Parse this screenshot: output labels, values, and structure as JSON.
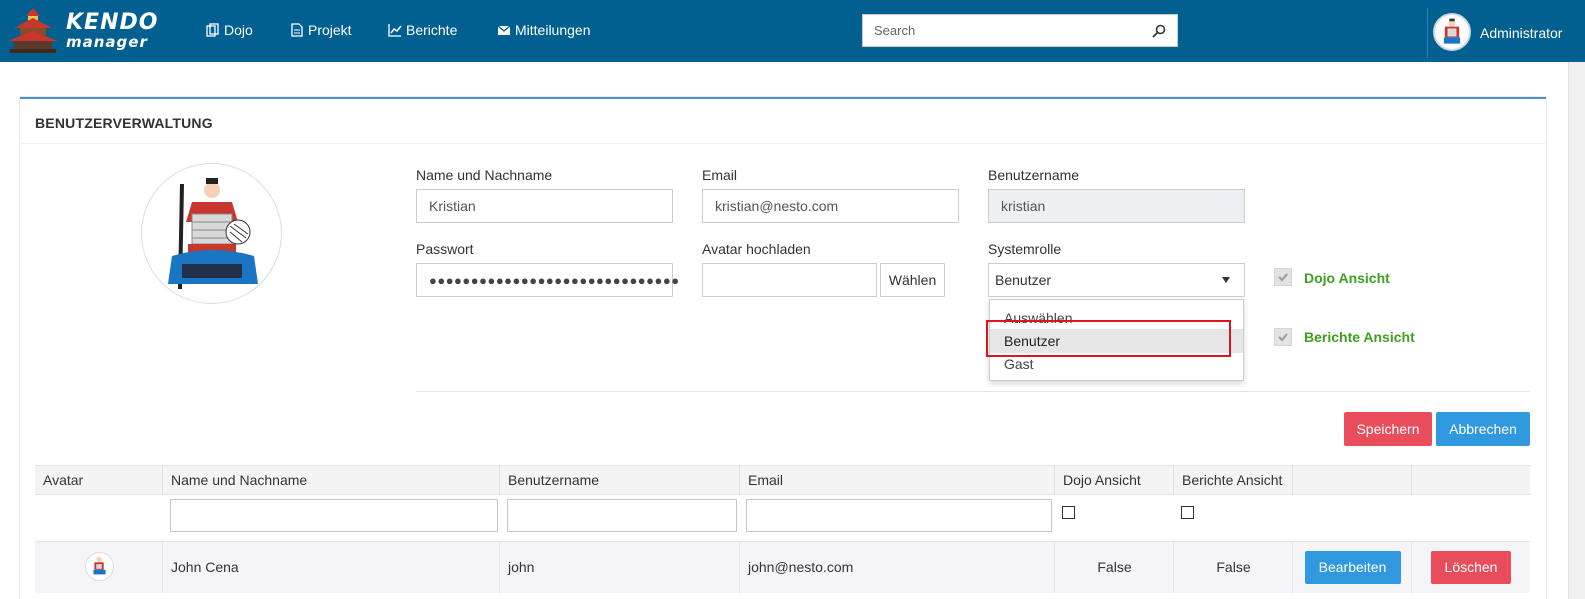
{
  "brand": {
    "line1": "KENDO",
    "line2": "manager"
  },
  "nav": [
    {
      "label": "Dojo",
      "icon": "copy-icon"
    },
    {
      "label": "Projekt",
      "icon": "document-icon"
    },
    {
      "label": "Berichte",
      "icon": "line-chart-icon"
    },
    {
      "label": "Mitteilungen",
      "icon": "envelope-icon"
    }
  ],
  "search": {
    "placeholder": "Search",
    "value": ""
  },
  "user": {
    "name": "Administrator"
  },
  "panel": {
    "title": "BENUTZERVERWALTUNG"
  },
  "form": {
    "name_label": "Name und Nachname",
    "name_value": "Kristian",
    "email_label": "Email",
    "email_value": "kristian@nesto.com",
    "username_label": "Benutzername",
    "username_value": "kristian",
    "password_label": "Passwort",
    "password_value": "●●●●●●●●●●●●●●●●●●●●●●●●●●●●●●",
    "avatar_label": "Avatar hochladen",
    "avatar_value": "",
    "choose_label": "Wählen",
    "role_label": "Systemrolle",
    "role_value": "Benutzer",
    "role_options": [
      "Auswählen",
      "Benutzer",
      "Gast"
    ],
    "dojo_view_label": "Dojo Ansicht",
    "reports_view_label": "Berichte Ansicht",
    "dojo_view_checked": true,
    "reports_view_checked": true
  },
  "actions": {
    "save": "Speichern",
    "cancel": "Abbrechen"
  },
  "table": {
    "headers": [
      "Avatar",
      "Name und Nachname",
      "Benutzername",
      "Email",
      "Dojo Ansicht",
      "Berichte Ansicht",
      "",
      ""
    ],
    "rows": [
      {
        "name": "John Cena",
        "username": "john",
        "email": "john@nesto.com",
        "dojo_view": "False",
        "reports_view": "False",
        "edit_label": "Bearbeiten",
        "delete_label": "Löschen"
      }
    ]
  },
  "colors": {
    "navbar": "#01608f",
    "danger": "#e94d5c",
    "primary": "#3098df",
    "success_text": "#3f9f1f",
    "highlight": "#e0141e"
  }
}
